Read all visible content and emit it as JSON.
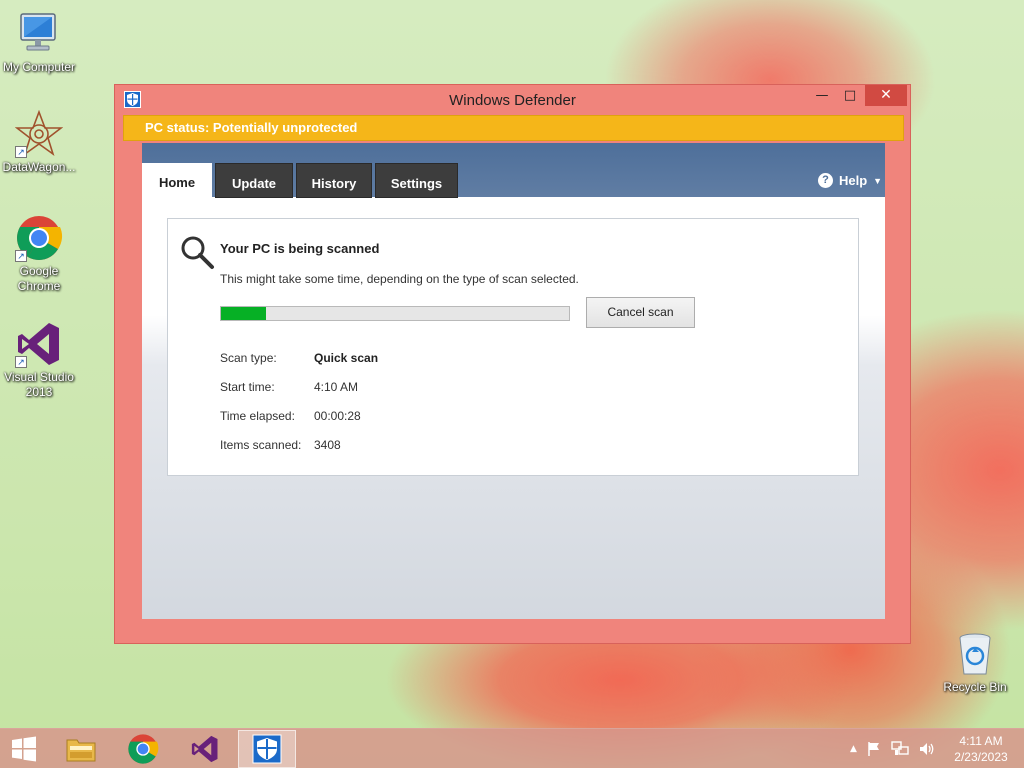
{
  "desktop": {
    "icons": [
      {
        "label": "My Computer",
        "icon": "monitor-icon"
      },
      {
        "label": "DataWagon...",
        "icon": "datawagon-icon"
      },
      {
        "label": "Google Chrome",
        "icon": "chrome-icon"
      },
      {
        "label": "Visual Studio 2013",
        "icon": "visual-studio-icon"
      },
      {
        "label": "Recycle Bin",
        "icon": "recycle-bin-icon"
      }
    ]
  },
  "window": {
    "title": "Windows Defender",
    "minimize_glyph": "—",
    "maximize_glyph": "□",
    "close_glyph": "✕",
    "status_text": "PC status: Potentially unprotected",
    "status_color": "#f5b619",
    "tabs": [
      {
        "label": "Home",
        "active": true
      },
      {
        "label": "Update",
        "active": false
      },
      {
        "label": "History",
        "active": false
      },
      {
        "label": "Settings",
        "active": false
      }
    ],
    "help_label": "Help",
    "scan": {
      "heading": "Your PC is being scanned",
      "subtext": "This might take some time, depending on the type of scan selected.",
      "progress_fraction": 0.13,
      "progress_color": "#06b025",
      "cancel_label": "Cancel scan",
      "rows": [
        {
          "label": "Scan type:",
          "value": "Quick scan"
        },
        {
          "label": "Start time:",
          "value": "4:10 AM"
        },
        {
          "label": "Time elapsed:",
          "value": "00:00:28"
        },
        {
          "label": "Items scanned:",
          "value": "3408"
        }
      ]
    }
  },
  "taskbar": {
    "items": [
      {
        "icon": "windows-start-icon"
      },
      {
        "icon": "file-explorer-icon"
      },
      {
        "icon": "chrome-icon"
      },
      {
        "icon": "visual-studio-icon"
      },
      {
        "icon": "windows-defender-icon",
        "active": true
      }
    ],
    "clock_time": "4:11 AM",
    "clock_date": "2/23/2023"
  }
}
